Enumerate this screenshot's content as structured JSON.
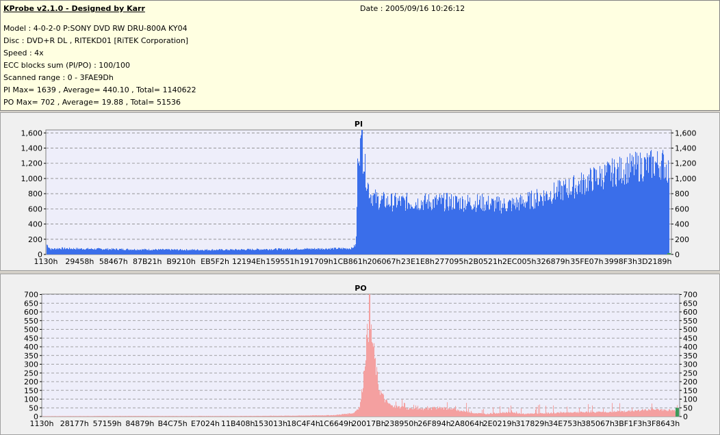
{
  "header": {
    "app_title": "KProbe v2.1.0 - Designed by Karr",
    "date_line": "Date : 2005/09/16 10:26:12",
    "lines": [
      "Model : 4-0-2-0 P:SONY    DVD RW DRU-800A  KY04",
      "Disc : DVD+R DL , RITEKD01 [RiTEK Corporation]",
      "Speed : 4x",
      "ECC blocks sum (PI/PO) : 100/100",
      "Scanned range : 0 - 3FAE9Dh",
      "PI Max= 1639 , Average= 440.10 , Total= 1140622",
      "PO Max= 702 , Average= 19.88 , Total= 51536"
    ]
  },
  "chart_data": [
    {
      "type": "area",
      "title": "PI",
      "ylim": [
        0,
        1639
      ],
      "yticks": [
        0,
        200,
        400,
        600,
        800,
        1000,
        1200,
        1400,
        1600
      ],
      "grid": true,
      "color": "#3a6eea",
      "xticks": [
        "1130h",
        "29458h",
        "58467h",
        "87B21h",
        "B9210h",
        "EB5F2h",
        "12194Eh",
        "159551h",
        "191709h",
        "1CB861h",
        "206067h",
        "23E1E8h",
        "277095h",
        "2B0521h",
        "2EC005h",
        "326879h",
        "35FE07h",
        "3998F3h",
        "3D2189h"
      ],
      "profile": [
        [
          0.0,
          130
        ],
        [
          0.006,
          70
        ],
        [
          0.02,
          80
        ],
        [
          0.05,
          75
        ],
        [
          0.1,
          70
        ],
        [
          0.15,
          65
        ],
        [
          0.2,
          62
        ],
        [
          0.25,
          60
        ],
        [
          0.3,
          62
        ],
        [
          0.35,
          68
        ],
        [
          0.4,
          72
        ],
        [
          0.44,
          75
        ],
        [
          0.49,
          80
        ],
        [
          0.497,
          130
        ],
        [
          0.499,
          900
        ],
        [
          0.5,
          1400
        ],
        [
          0.503,
          1420
        ],
        [
          0.507,
          1350
        ],
        [
          0.51,
          1200
        ],
        [
          0.515,
          950
        ],
        [
          0.52,
          800
        ],
        [
          0.53,
          720
        ],
        [
          0.55,
          690
        ],
        [
          0.6,
          690
        ],
        [
          0.65,
          690
        ],
        [
          0.7,
          680
        ],
        [
          0.73,
          650
        ],
        [
          0.75,
          660
        ],
        [
          0.78,
          720
        ],
        [
          0.81,
          800
        ],
        [
          0.85,
          900
        ],
        [
          0.88,
          1000
        ],
        [
          0.91,
          1080
        ],
        [
          0.94,
          1140
        ],
        [
          0.97,
          1180
        ],
        [
          0.99,
          1200
        ],
        [
          1.0,
          1100
        ]
      ],
      "spikes": [
        [
          0.507,
          1639
        ]
      ]
    },
    {
      "type": "area",
      "title": "PO",
      "ylim": [
        0,
        702
      ],
      "yticks": [
        0,
        50,
        100,
        150,
        200,
        250,
        300,
        350,
        400,
        450,
        500,
        550,
        600,
        650,
        700
      ],
      "grid": true,
      "color": "#f4a0a0",
      "xticks": [
        "1130h",
        "28177h",
        "57159h",
        "84879h",
        "B4C75h",
        "E7024h",
        "11B408h",
        "153013h",
        "18C4F4h",
        "1C6649h",
        "20017Bh",
        "238950h",
        "26F894h",
        "2A8064h",
        "2E0219h",
        "317829h",
        "34E753h",
        "385067h",
        "3BF1F3h",
        "3F8643h"
      ],
      "profile": [
        [
          0.0,
          2
        ],
        [
          0.1,
          3
        ],
        [
          0.2,
          3
        ],
        [
          0.3,
          3
        ],
        [
          0.4,
          5
        ],
        [
          0.46,
          8
        ],
        [
          0.49,
          20
        ],
        [
          0.5,
          60
        ],
        [
          0.505,
          200
        ],
        [
          0.51,
          420
        ],
        [
          0.515,
          550
        ],
        [
          0.52,
          420
        ],
        [
          0.525,
          280
        ],
        [
          0.53,
          160
        ],
        [
          0.54,
          90
        ],
        [
          0.55,
          60
        ],
        [
          0.58,
          45
        ],
        [
          0.6,
          40
        ],
        [
          0.62,
          50
        ],
        [
          0.65,
          40
        ],
        [
          0.68,
          20
        ],
        [
          0.7,
          15
        ],
        [
          0.73,
          25
        ],
        [
          0.76,
          15
        ],
        [
          0.8,
          20
        ],
        [
          0.84,
          25
        ],
        [
          0.88,
          25
        ],
        [
          0.92,
          30
        ],
        [
          0.96,
          40
        ],
        [
          1.0,
          35
        ]
      ],
      "spikes": [
        [
          0.515,
          702
        ]
      ]
    }
  ]
}
